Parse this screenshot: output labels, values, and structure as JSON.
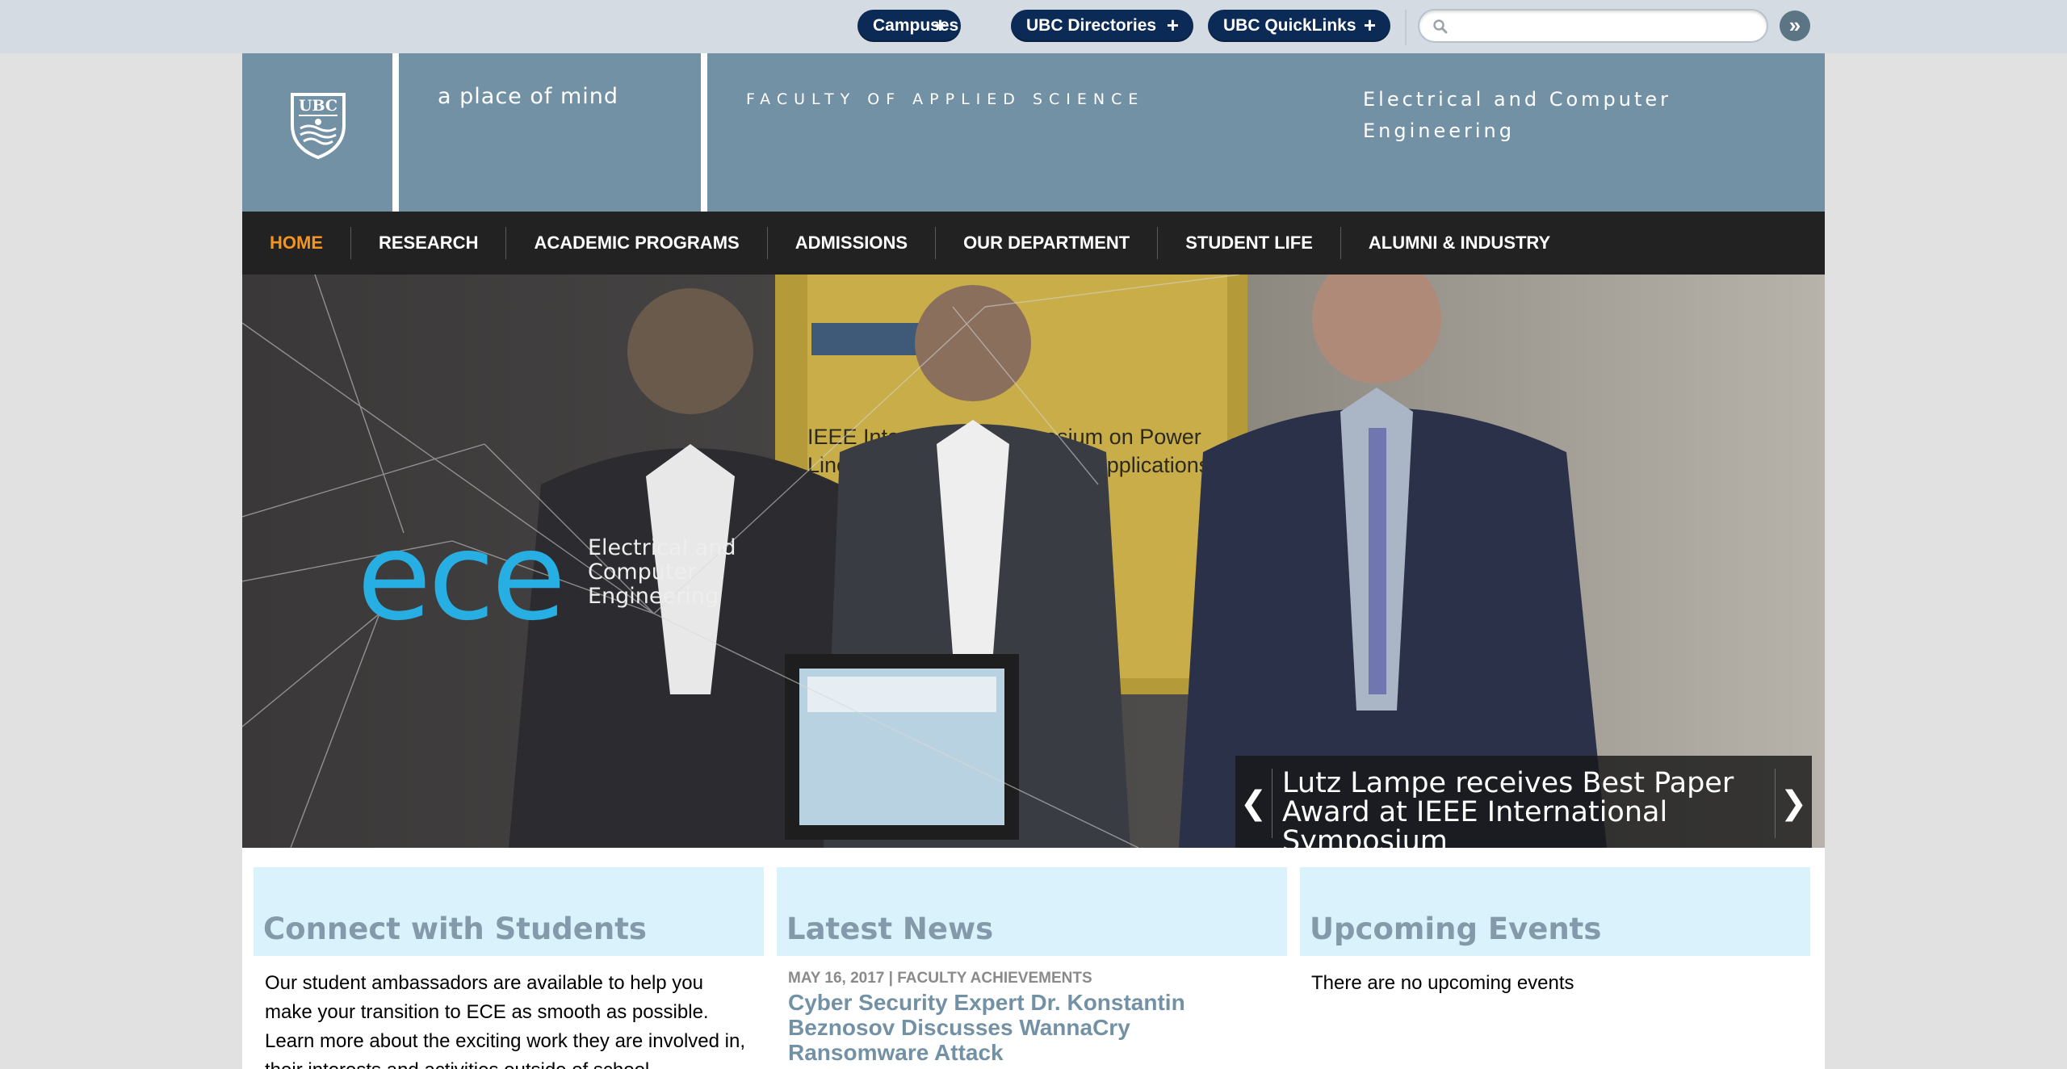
{
  "topbar": {
    "links": [
      {
        "label": "Campuses"
      },
      {
        "label": "UBC Directories"
      },
      {
        "label": "UBC QuickLinks"
      }
    ],
    "search_placeholder": "",
    "search_go_label": "»"
  },
  "header": {
    "logo_text": "UBC",
    "tagline": "a place of mind",
    "faculty": "FACULTY OF APPLIED SCIENCE",
    "department_line1": "Electrical and Computer",
    "department_line2": "Engineering"
  },
  "nav": {
    "items": [
      {
        "label": "HOME",
        "active": true
      },
      {
        "label": "RESEARCH"
      },
      {
        "label": "ACADEMIC PROGRAMS"
      },
      {
        "label": "ADMISSIONS"
      },
      {
        "label": "OUR DEPARTMENT"
      },
      {
        "label": "STUDENT LIFE"
      },
      {
        "label": "ALUMNI & INDUSTRY"
      }
    ]
  },
  "hero": {
    "brand_mark": "ece",
    "brand_text_line1": "Electrical and",
    "brand_text_line2": "Computer",
    "brand_text_line3": "Engineering",
    "banner_text_line1": "IEEE International Symposium on Power",
    "banner_text_line2": "Line Communications and its Applications",
    "caption": "Lutz Lampe receives Best Paper Award at IEEE International Symposium",
    "prev_label": "❮",
    "next_label": "❯"
  },
  "columns": {
    "students": {
      "title": "Connect with Students",
      "body": "Our student ambassadors are available to help you make your transition to ECE as smooth as possible. Learn more about the exciting work they are involved in, their interests and activities outside of school."
    },
    "news": {
      "title": "Latest News",
      "meta": "MAY 16, 2017 | FACULTY ACHIEVEMENTS",
      "headline": "Cyber Security Expert Dr. Konstantin Beznosov Discusses WannaCry Ransomware Attack"
    },
    "events": {
      "title": "Upcoming Events",
      "body": "There are no upcoming events"
    }
  },
  "colors": {
    "header_blue": "#7391a4",
    "nav_black": "#222222",
    "nav_active": "#f7941d",
    "pill_navy": "#0b2a55",
    "column_head": "#d9f2fb",
    "ece_blue": "#27aee3"
  }
}
